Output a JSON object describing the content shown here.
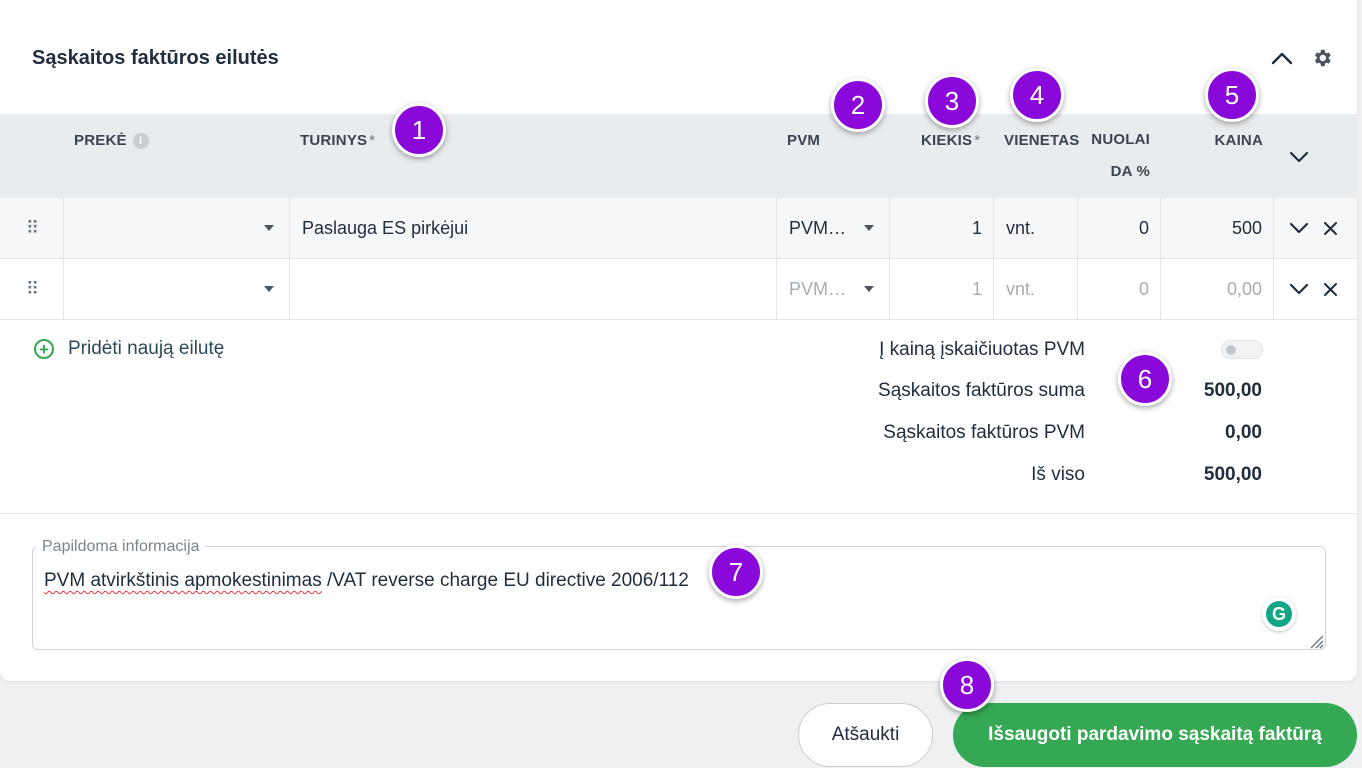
{
  "section": {
    "title": "Sąskaitos faktūros eilutės"
  },
  "icons": {
    "collapse": "chevron-up-icon",
    "settings": "gear-icon",
    "info": "info-icon",
    "add": "plus-circle-icon"
  },
  "columns": {
    "preke": "PREKĖ",
    "turinys": "TURINYS",
    "pvm": "PVM",
    "kiekis": "KIEKIS",
    "vienetas": "VIENETAS",
    "nuolaida_line1": "NUOLAI",
    "nuolaida_line2": "DA %",
    "kaina": "KAINA",
    "required_mark": "*",
    "info_glyph": "i"
  },
  "rows": [
    {
      "preke": "",
      "turinys": "Paslauga ES pirkėjui",
      "pvm": "PVM…",
      "kiekis": "1",
      "vienetas": "vnt.",
      "nuolaida": "0",
      "kaina": "500"
    },
    {
      "preke": "",
      "turinys": "",
      "pvm": "PVM…",
      "kiekis": "1",
      "vienetas": "vnt.",
      "nuolaida": "0",
      "kaina": "0,00"
    }
  ],
  "add_row_label": "Pridėti naują eilutę",
  "summary": {
    "vat_included_label": "Į kainą įskaičiuotas PVM",
    "vat_included": false,
    "sum_label": "Sąskaitos faktūros suma",
    "sum_value": "500,00",
    "vat_label": "Sąskaitos faktūros PVM",
    "vat_value": "0,00",
    "total_label": "Iš viso",
    "total_value": "500,00"
  },
  "extra_info": {
    "legend": "Papildoma informacija",
    "value_misspelled": "PVM atvirkštinis apmokestinimas",
    "value_rest": " /VAT reverse charge EU directive 2006/112"
  },
  "grammarly_glyph": "G",
  "buttons": {
    "cancel": "Atšaukti",
    "save": "Išsaugoti pardavimo sąskaitą faktūrą"
  },
  "badges": [
    "1",
    "2",
    "3",
    "4",
    "5",
    "6",
    "7",
    "8"
  ],
  "colors": {
    "accent_green": "#34a853",
    "badge_purple": "#8a08d9",
    "header_bg": "#e9ecee"
  }
}
